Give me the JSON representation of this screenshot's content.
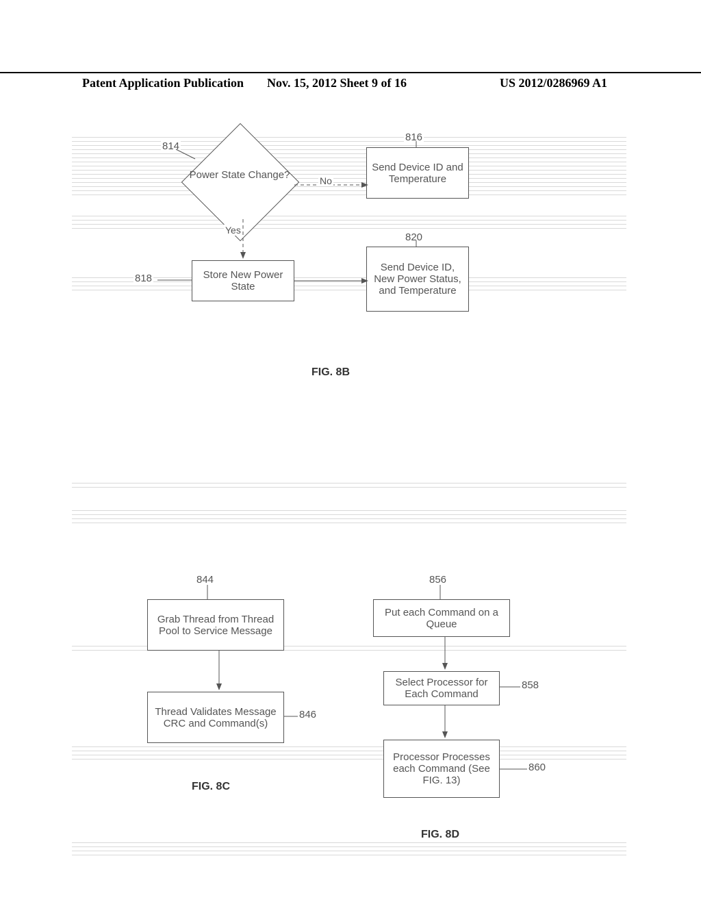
{
  "header": {
    "left": "Patent Application Publication",
    "mid": "Nov. 15, 2012  Sheet 9 of 16",
    "right": "US 2012/0286969 A1"
  },
  "fig8b": {
    "caption": "FIG. 8B",
    "decision": {
      "ref": "814",
      "text": "Power State Change?"
    },
    "no_label": "No",
    "yes_label": "Yes",
    "box816": {
      "ref": "816",
      "text": "Send Device ID and Temperature"
    },
    "box818": {
      "ref": "818",
      "text": "Store New Power State"
    },
    "box820": {
      "ref": "820",
      "text": "Send Device ID, New Power Status, and Temperature"
    }
  },
  "fig8c": {
    "caption": "FIG. 8C",
    "box844": {
      "ref": "844",
      "text": "Grab Thread from Thread Pool to Service Message"
    },
    "box846": {
      "ref": "846",
      "text": "Thread Validates Message CRC and Command(s)"
    }
  },
  "fig8d": {
    "caption": "FIG. 8D",
    "box856": {
      "ref": "856",
      "text": "Put each Command on a Queue"
    },
    "box858": {
      "ref": "858",
      "text": "Select Processor for Each Command"
    },
    "box860": {
      "ref": "860",
      "text": "Processor Processes each Command (See FIG. 13)"
    }
  }
}
